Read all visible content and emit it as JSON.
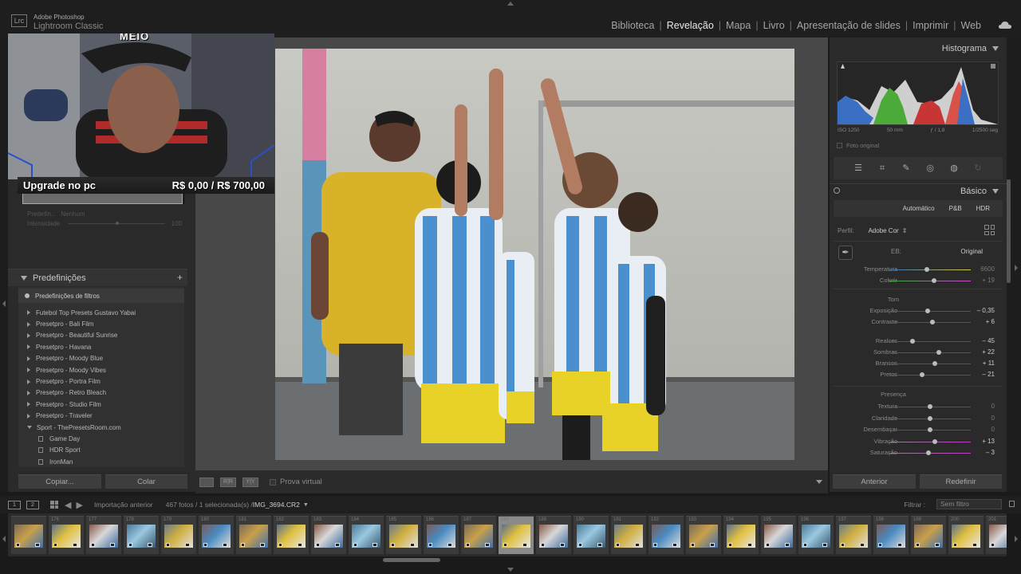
{
  "app": {
    "logo_text": "Lrc",
    "vendor": "Adobe Photoshop",
    "name": "Lightroom Classic"
  },
  "modules": [
    {
      "label": "Biblioteca",
      "active": false
    },
    {
      "label": "Revelação",
      "active": true
    },
    {
      "label": "Mapa",
      "active": false
    },
    {
      "label": "Livro",
      "active": false
    },
    {
      "label": "Apresentação de slides",
      "active": false
    },
    {
      "label": "Imprimir",
      "active": false
    },
    {
      "label": "Web",
      "active": false
    }
  ],
  "webcam": {
    "overlay_text": "MEIO",
    "caption_left": "Upgrade no pc",
    "caption_right": "R$ 0,00 / R$ 700,00"
  },
  "left_panel": {
    "preset_label": "Predefin.:",
    "preset_value": "Nenhum",
    "intensity_label": "Intensidade",
    "intensity_value": "100",
    "presets_header": "Predefinições",
    "filter_row": "Predefinições de filtros",
    "preset_groups": [
      "Futebol Top Presets Gustavo Yabai",
      "Presetpro - Bali Film",
      "Presetpro - Beautiful Sunrise",
      "Presetpro - Havana",
      "Presetpro - Moody Blue",
      "Presetpro - Moody Vibes",
      "Presetpro - Portra Film",
      "Presetpro - Retro Bleach",
      "Presetpro - Studio Film",
      "Presetpro - Traveler"
    ],
    "expanded_group": "Sport - ThePresetsRoom.com",
    "expanded_items": [
      "Game Day",
      "HDR Sport",
      "IronMan"
    ],
    "copy_button": "Copiar...",
    "paste_button": "Colar"
  },
  "toolbar": {
    "view_a": "R|R",
    "view_b": "Y|Y",
    "soft_proof": "Prova virtual"
  },
  "right_panel": {
    "histogram_title": "Histograma",
    "exif": [
      "ISO 1250",
      "50 mm",
      "ƒ / 1,8",
      "1/2500 seg"
    ],
    "original_photo": "Foto original",
    "basic_title": "Básico",
    "treatments": [
      "Automático",
      "P&B",
      "HDR"
    ],
    "profile_label": "Perfil:",
    "profile_value": "Adobe Cor",
    "wb_label": "EB:",
    "wb_value": "Original",
    "sliders_wb": [
      {
        "label": "Temperatura",
        "value": "6600",
        "pos": 0.46,
        "dim": true
      },
      {
        "label": "Colorir",
        "value": "+ 19",
        "pos": 0.55,
        "dim": true
      }
    ],
    "tone_label": "Tom",
    "sliders_tone": [
      {
        "label": "Exposição",
        "value": "– 0,35",
        "pos": 0.47
      },
      {
        "label": "Contraste",
        "value": "+ 6",
        "pos": 0.53
      }
    ],
    "sliders_tone2": [
      {
        "label": "Realces",
        "value": "– 45",
        "pos": 0.28
      },
      {
        "label": "Sombras",
        "value": "+ 22",
        "pos": 0.61
      },
      {
        "label": "Brancos",
        "value": "+ 11",
        "pos": 0.56
      },
      {
        "label": "Pretos",
        "value": "– 21",
        "pos": 0.4
      }
    ],
    "presence_label": "Presença",
    "sliders_presence": [
      {
        "label": "Textura",
        "value": "0",
        "pos": 0.5,
        "dim": true
      },
      {
        "label": "Claridade",
        "value": "0",
        "pos": 0.5,
        "dim": true
      },
      {
        "label": "Desembaçar",
        "value": "0",
        "pos": 0.5,
        "dim": true
      },
      {
        "label": "Vibração",
        "value": "+ 13",
        "pos": 0.56
      },
      {
        "label": "Saturação",
        "value": "– 3",
        "pos": 0.48
      }
    ],
    "prev_button": "Anterior",
    "reset_button": "Redefinir"
  },
  "filmbar": {
    "screen1": "1",
    "screen2": "2",
    "source": "Importação anterior",
    "info": "467 fotos / 1 selecionada(s) /",
    "filename": "IMG_3694.CR2",
    "filter_label": "Filtrar :",
    "filter_value": "Sem filtro"
  },
  "filmstrip_numbers": [
    "",
    "176",
    "177",
    "178",
    "179",
    "180",
    "181",
    "182",
    "183",
    "184",
    "185",
    "186",
    "187",
    "188",
    "189",
    "190",
    "191",
    "192",
    "193",
    "194",
    "195",
    "196",
    "197",
    "198",
    "199",
    "200",
    "201"
  ],
  "filmstrip_selected_index": 13,
  "colors": {
    "panel": "#2a2a2a",
    "center": "#484848",
    "accent_text": "#e8e8e8"
  }
}
